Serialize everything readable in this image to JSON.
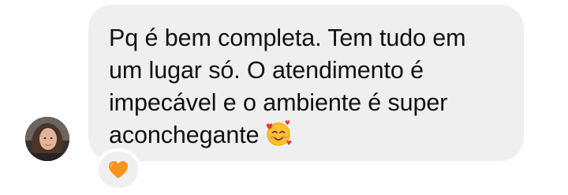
{
  "message": {
    "text_line_1": "Pq é bem completa.  Tem tudo em",
    "text_line_2": "um lugar só.  O atendimento é",
    "text_line_3": "impecável e o ambiente é super",
    "text_line_4": "aconchegante",
    "trailing_emoji": "smiling-face-with-hearts-icon"
  },
  "reaction": {
    "icon": "orange-heart-icon",
    "color": "#f7931e"
  },
  "colors": {
    "bubble": "#efefef",
    "text": "#111111",
    "background": "#ffffff"
  }
}
